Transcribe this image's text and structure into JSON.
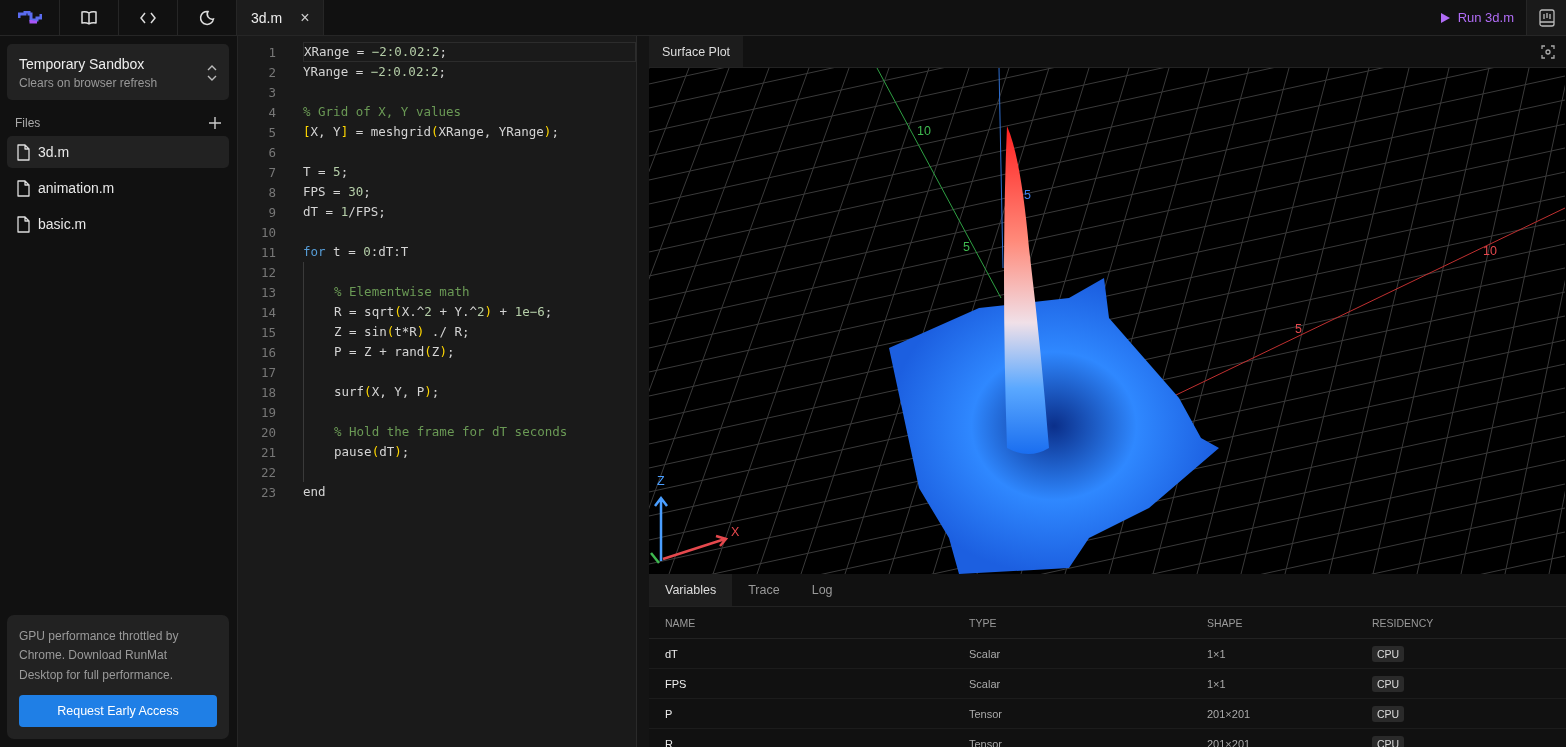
{
  "topbar": {
    "tabs": [
      {
        "label": "3d.m",
        "close": "×"
      }
    ],
    "run_button": "Run 3d.m"
  },
  "sidebar": {
    "workspace": {
      "title": "Temporary Sandbox",
      "subtitle": "Clears on browser refresh"
    },
    "files_label": "Files",
    "files": [
      {
        "name": "3d.m",
        "selected": true
      },
      {
        "name": "animation.m",
        "selected": false
      },
      {
        "name": "basic.m",
        "selected": false
      }
    ],
    "notice": {
      "text": "GPU performance throttled by Chrome. Download RunMat Desktop for full performance.",
      "button": "Request Early Access"
    }
  },
  "editor": {
    "lines": [
      {
        "number": "1",
        "current": true,
        "tokens": [
          {
            "kind": "plain",
            "text": "XRange = "
          },
          {
            "kind": "number",
            "text": "−2:0.02:2"
          },
          {
            "kind": "plain",
            "text": ";"
          }
        ]
      },
      {
        "number": "2",
        "current": false,
        "tokens": [
          {
            "kind": "plain",
            "text": "YRange = "
          },
          {
            "kind": "number",
            "text": "−2:0.02:2"
          },
          {
            "kind": "plain",
            "text": ";"
          }
        ]
      },
      {
        "number": "3",
        "current": false
      },
      {
        "number": "4",
        "current": false,
        "tokens": [
          {
            "kind": "comment",
            "text": "% Grid of X, Y values"
          }
        ]
      },
      {
        "number": "5",
        "current": false,
        "tokens": [
          {
            "kind": "bracket",
            "text": "["
          },
          {
            "kind": "plain",
            "text": "X, Y"
          },
          {
            "kind": "bracket",
            "text": "]"
          },
          {
            "kind": "plain",
            "text": " = meshgrid"
          },
          {
            "kind": "bracket",
            "text": "("
          },
          {
            "kind": "plain",
            "text": "XRange, YRange"
          },
          {
            "kind": "bracket",
            "text": ")"
          },
          {
            "kind": "plain",
            "text": ";"
          }
        ]
      },
      {
        "number": "6",
        "current": false
      },
      {
        "number": "7",
        "current": false,
        "tokens": [
          {
            "kind": "plain",
            "text": "T = "
          },
          {
            "kind": "number",
            "text": "5"
          },
          {
            "kind": "plain",
            "text": ";"
          }
        ]
      },
      {
        "number": "8",
        "current": false,
        "tokens": [
          {
            "kind": "plain",
            "text": "FPS = "
          },
          {
            "kind": "number",
            "text": "30"
          },
          {
            "kind": "plain",
            "text": ";"
          }
        ]
      },
      {
        "number": "9",
        "current": false,
        "tokens": [
          {
            "kind": "plain",
            "text": "dT = "
          },
          {
            "kind": "number",
            "text": "1"
          },
          {
            "kind": "plain",
            "text": "/FPS;"
          }
        ]
      },
      {
        "number": "10",
        "current": false
      },
      {
        "number": "11",
        "current": false,
        "tokens": [
          {
            "kind": "keyword",
            "text": "for"
          },
          {
            "kind": "plain",
            "text": " t = "
          },
          {
            "kind": "number",
            "text": "0"
          },
          {
            "kind": "plain",
            "text": ":dT:T"
          }
        ],
        "children": [
          {
            "number": "12",
            "current": false
          },
          {
            "number": "13",
            "current": false,
            "tokens": [
              {
                "kind": "comment",
                "text": "% Elementwise math"
              }
            ]
          },
          {
            "number": "14",
            "current": false,
            "tokens": [
              {
                "kind": "plain",
                "text": "R = sqrt"
              },
              {
                "kind": "bracket",
                "text": "("
              },
              {
                "kind": "plain",
                "text": "X.^"
              },
              {
                "kind": "number",
                "text": "2"
              },
              {
                "kind": "plain",
                "text": " + Y.^"
              },
              {
                "kind": "number",
                "text": "2"
              },
              {
                "kind": "bracket",
                "text": ")"
              },
              {
                "kind": "plain",
                "text": " + "
              },
              {
                "kind": "number",
                "text": "1e−6"
              },
              {
                "kind": "plain",
                "text": ";"
              }
            ]
          },
          {
            "number": "15",
            "current": false,
            "tokens": [
              {
                "kind": "plain",
                "text": "Z = sin"
              },
              {
                "kind": "bracket",
                "text": "("
              },
              {
                "kind": "plain",
                "text": "t*R"
              },
              {
                "kind": "bracket",
                "text": ")"
              },
              {
                "kind": "plain",
                "text": " ./ R;"
              }
            ]
          },
          {
            "number": "16",
            "current": false,
            "tokens": [
              {
                "kind": "plain",
                "text": "P = Z + rand"
              },
              {
                "kind": "bracket",
                "text": "("
              },
              {
                "kind": "plain",
                "text": "Z"
              },
              {
                "kind": "bracket",
                "text": ")"
              },
              {
                "kind": "plain",
                "text": ";"
              }
            ]
          },
          {
            "number": "17",
            "current": false
          },
          {
            "number": "18",
            "current": false,
            "tokens": [
              {
                "kind": "plain",
                "text": "surf"
              },
              {
                "kind": "bracket",
                "text": "("
              },
              {
                "kind": "plain",
                "text": "X, Y, P"
              },
              {
                "kind": "bracket",
                "text": ")"
              },
              {
                "kind": "plain",
                "text": ";"
              }
            ]
          },
          {
            "number": "19",
            "current": false
          },
          {
            "number": "20",
            "current": false,
            "tokens": [
              {
                "kind": "comment",
                "text": "% Hold the frame for dT seconds"
              }
            ]
          },
          {
            "number": "21",
            "current": false,
            "tokens": [
              {
                "kind": "plain",
                "text": "pause"
              },
              {
                "kind": "bracket",
                "text": "("
              },
              {
                "kind": "plain",
                "text": "dT"
              },
              {
                "kind": "bracket",
                "text": ")"
              },
              {
                "kind": "plain",
                "text": ";"
              }
            ]
          },
          {
            "number": "22",
            "current": false
          }
        ]
      },
      {
        "number": "23",
        "current": false,
        "tokens": [
          {
            "kind": "plain",
            "text": "end"
          }
        ]
      }
    ]
  },
  "plot": {
    "tabs": [
      {
        "label": "Surface Plot"
      }
    ],
    "axis_labels": [
      {
        "text": "10",
        "color": "#3fb950"
      },
      {
        "text": "5",
        "color": "#3fb950"
      },
      {
        "text": "5",
        "color": "#3b82f6"
      },
      {
        "text": "10",
        "color": "#e5484d"
      },
      {
        "text": "5",
        "color": "#e5484d"
      }
    ],
    "gizmo_labels": [
      {
        "text": "Z",
        "color": "#4a9eff"
      },
      {
        "text": "X",
        "color": "#e5484d"
      }
    ]
  },
  "bottom_panel": {
    "tabs": [
      {
        "label": "Variables",
        "selected": true
      },
      {
        "label": "Trace",
        "selected": false
      },
      {
        "label": "Log",
        "selected": false
      }
    ],
    "columns": [
      "NAME",
      "TYPE",
      "SHAPE",
      "RESIDENCY"
    ],
    "rows": [
      [
        "dT",
        "Scalar",
        "1×1",
        "CPU"
      ],
      [
        "FPS",
        "Scalar",
        "1×1",
        "CPU"
      ],
      [
        "P",
        "Tensor",
        "201×201",
        "CPU"
      ],
      [
        "R",
        "Tensor",
        "201×201",
        "CPU"
      ]
    ]
  }
}
